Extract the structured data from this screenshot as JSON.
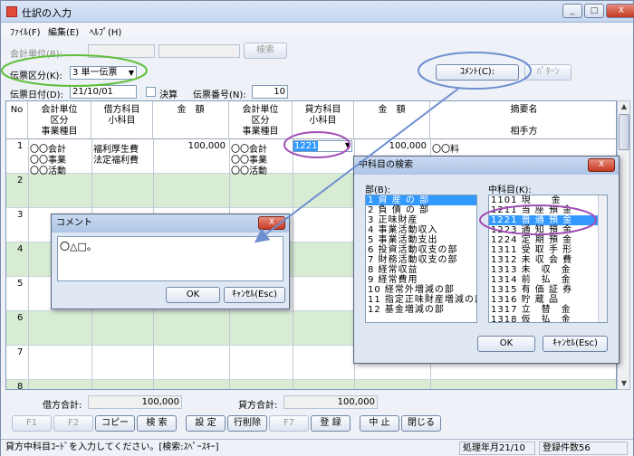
{
  "window": {
    "title": "仕訳の入力",
    "minimize": "_",
    "maximize": "□",
    "close": "X"
  },
  "menu": [
    "ﾌｧｲﾙ(F)",
    "編集(E)",
    "ﾍﾙﾌﾟ(H)"
  ],
  "form": {
    "unit_label": "会計単位(B):",
    "search_btn": "検索",
    "slip_type_label": "伝票区分(K):",
    "slip_type_value": "3 単一伝票",
    "slip_date_label": "伝票日付(D):",
    "slip_date_value": "21/10/01",
    "settle_label": "決算",
    "slip_no_label": "伝票番号(N):",
    "slip_no_value": "10",
    "comment_btn": "ｺﾒﾝﾄ(C):",
    "pattern_btn": "ﾊﾟﾀｰﾝ"
  },
  "grid": {
    "headers": [
      "No",
      "会計単位\n区分\n事業種目",
      "借方科目\n小科目",
      "金　額",
      "会計単位\n区分\n事業種目",
      "貸方科目\n小科目",
      "金　額",
      "摘要名\n\n相手方"
    ],
    "row1": {
      "no": "1",
      "debit_unit": [
        "〇〇会計",
        "〇〇事業",
        "〇〇活動"
      ],
      "debit_account": [
        "福利厚生費",
        "法定福利費"
      ],
      "debit_amount": "100,000",
      "credit_unit": [
        "〇〇会計",
        "〇〇事業",
        "〇〇活動"
      ],
      "credit_account": "1221",
      "credit_amount": "100,000",
      "summary": "〇〇料"
    },
    "row_numbers": [
      "2",
      "3",
      "4",
      "5",
      "6",
      "7",
      "8"
    ]
  },
  "totals": {
    "debit_label": "借方合計:",
    "debit_value": "100,000",
    "credit_label": "貸方合計:",
    "credit_value": "100,000"
  },
  "fkeys": [
    "F1",
    "F2",
    "コピー",
    "検 索",
    "設 定",
    "行削除",
    "F7",
    "登 録",
    "中 止",
    "閉じる"
  ],
  "status": {
    "message": "貸方中科目ｺｰﾄﾞを入力してください。[検索:ｽﾍﾟｰｽｷｰ]",
    "period": "処理年月21/10",
    "count": "登録件数56"
  },
  "comment_dialog": {
    "title": "コメント",
    "text": "〇△□。",
    "ok": "OK",
    "cancel": "ｷｬﾝｾﾙ(Esc)",
    "close": "X"
  },
  "account_dialog": {
    "title": "中科目の検索",
    "section_label": "部(B):",
    "section_items": [
      "1 資 産 の 部",
      "2 負 債 の 部",
      "3 正味財産",
      "4 事業活動収入",
      "5 事業活動支出",
      "6 投資活動収支の部",
      "7 財務活動収支の部",
      "8 経常収益",
      "9 経常費用",
      "10 経常外増減の部",
      "11 指定正味財産増減の部",
      "12 基金増減の部"
    ],
    "account_label": "中科目(K):",
    "account_items": [
      "1101 現　　金",
      "1211 当 座 預 金",
      "1221 普 通 預 金",
      "1223 通 知 預 金",
      "1224 定 期 預 金",
      "1311 受 取 手 形",
      "1312 未 収 会 費",
      "1313 未　収　金",
      "1314 前　払　金",
      "1315 有 価 証 券",
      "1316 貯 蔵 品",
      "1317 立　替　金",
      "1318 仮　払　金"
    ],
    "ok": "OK",
    "cancel": "ｷｬﾝｾﾙ(Esc)",
    "close": "X"
  },
  "colors": {
    "highlight": "#3399ff",
    "green_row": "#d8ecd3",
    "annot_green": "#5fbf3a",
    "annot_blue": "#6e8fcf",
    "annot_purple": "#a14db5"
  }
}
